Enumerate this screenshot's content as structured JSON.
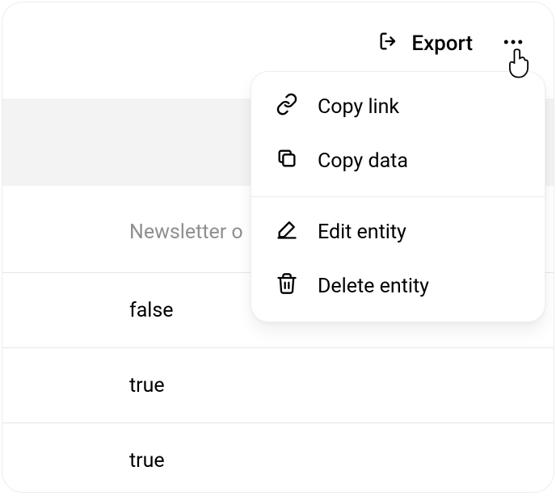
{
  "topbar": {
    "export_label": "Export"
  },
  "table": {
    "header": "Newsletter o",
    "rows": [
      "false",
      "true",
      "true"
    ]
  },
  "menu": {
    "copy_link": "Copy link",
    "copy_data": "Copy data",
    "edit_entity": "Edit entity",
    "delete_entity": "Delete entity"
  }
}
